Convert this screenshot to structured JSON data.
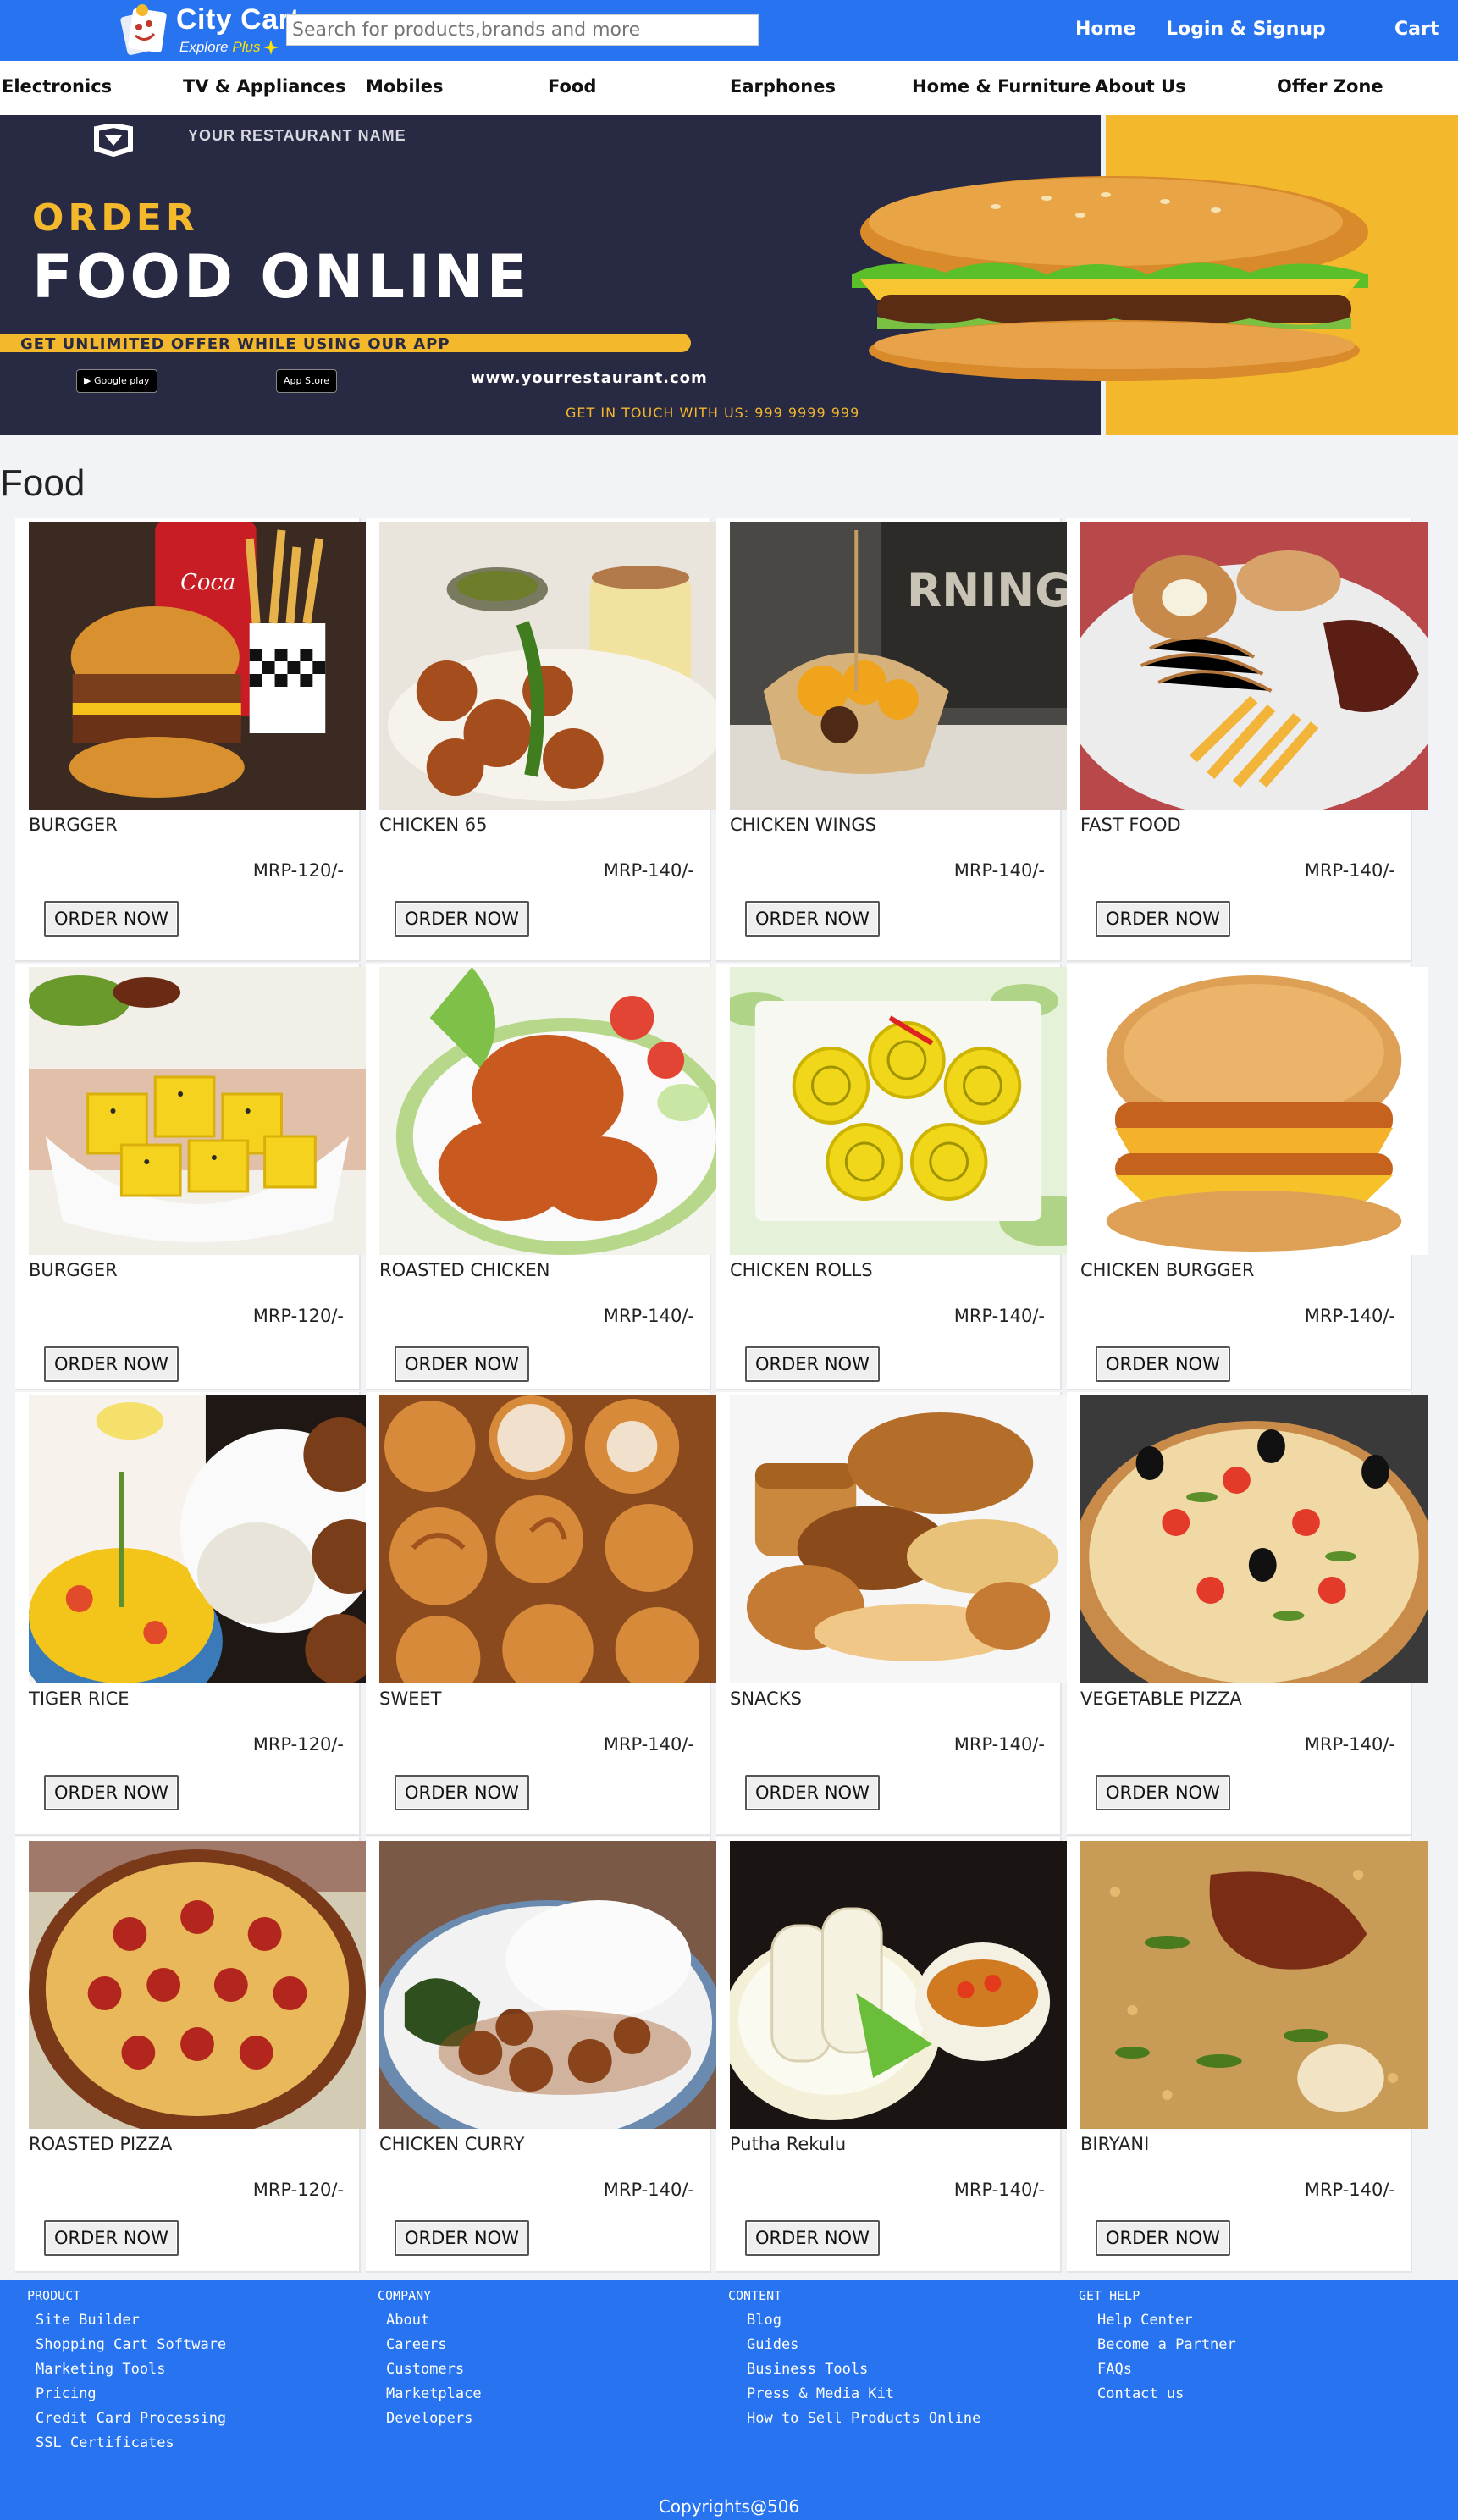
{
  "header": {
    "brand": "City Cart",
    "tagline_explore": "Explore",
    "tagline_plus": "Plus",
    "search_placeholder": "Search for products,brands and more",
    "nav": {
      "home": "Home",
      "login": "Login & Signup",
      "cart": "Cart"
    },
    "brand_color": "#2874f0"
  },
  "categories": [
    "Electronics",
    "TV & Appliances",
    "Mobiles",
    "Food",
    "Earphones",
    "Home & Furniture",
    "About Us",
    "Offer Zone"
  ],
  "banner": {
    "restaurant_name": "YOUR RESTAURANT NAME",
    "order": "ORDER",
    "headline": "FOOD ONLINE",
    "offer": "GET UNLIMITED OFFER WHILE USING OUR APP",
    "google_play": "Google play",
    "app_store": "App Store",
    "url": "www.yourrestaurant.com",
    "contact": "GET IN TOUCH WITH US: 999 9999 999",
    "colors": {
      "dark": "#282942",
      "accent": "#f4b82c"
    }
  },
  "section_title": "Food",
  "order_label": "ORDER NOW",
  "products": [
    {
      "name": "BURGGER",
      "price": "MRP-120/-",
      "image": "burger-with-fries-icon"
    },
    {
      "name": "CHICKEN 65",
      "price": "MRP-140/-",
      "image": "chicken-65-icon"
    },
    {
      "name": "CHICKEN WINGS",
      "price": "MRP-140/-",
      "image": "chicken-wrap-icon"
    },
    {
      "name": "FAST FOOD",
      "price": "MRP-140/-",
      "image": "fast-food-platter-icon"
    },
    {
      "name": "BURGGER",
      "price": "MRP-120/-",
      "image": "dhokla-icon"
    },
    {
      "name": "ROASTED CHICKEN",
      "price": "MRP-140/-",
      "image": "roasted-chicken-icon"
    },
    {
      "name": "CHICKEN ROLLS",
      "price": "MRP-140/-",
      "image": "rolls-icon"
    },
    {
      "name": "CHICKEN BURGGER",
      "price": "MRP-140/-",
      "image": "cheese-burger-icon"
    },
    {
      "name": "TIGER RICE",
      "price": "MRP-120/-",
      "image": "rice-and-cutlets-icon"
    },
    {
      "name": "SWEET",
      "price": "MRP-140/-",
      "image": "pastries-icon"
    },
    {
      "name": "SNACKS",
      "price": "MRP-140/-",
      "image": "breads-icon"
    },
    {
      "name": "VEGETABLE PIZZA",
      "price": "MRP-140/-",
      "image": "veg-pizza-icon"
    },
    {
      "name": "ROASTED PIZZA",
      "price": "MRP-120/-",
      "image": "pepperoni-pizza-icon"
    },
    {
      "name": "CHICKEN CURRY",
      "price": "MRP-140/-",
      "image": "curry-plate-icon"
    },
    {
      "name": "Putha Rekulu",
      "price": "MRP-140/-",
      "image": "putha-rekulu-icon"
    },
    {
      "name": "BIRYANI",
      "price": "MRP-140/-",
      "image": "biryani-icon"
    }
  ],
  "footer": {
    "columns": [
      {
        "heading": "PRODUCT",
        "links": [
          "Site Builder",
          "Shopping Cart Software",
          "Marketing Tools",
          "Pricing",
          "Credit Card Processing",
          "SSL Certificates"
        ]
      },
      {
        "heading": "COMPANY",
        "links": [
          "About",
          "Careers",
          "Customers",
          "Marketplace",
          "Developers"
        ]
      },
      {
        "heading": "CONTENT",
        "links": [
          "Blog",
          "Guides",
          "Business Tools",
          "Press & Media Kit",
          "How to Sell Products Online"
        ]
      },
      {
        "heading": "GET HELP",
        "links": [
          "Help Center",
          "Become a Partner",
          "FAQs",
          "Contact us"
        ]
      }
    ],
    "copyright": "Copyrights@506"
  }
}
